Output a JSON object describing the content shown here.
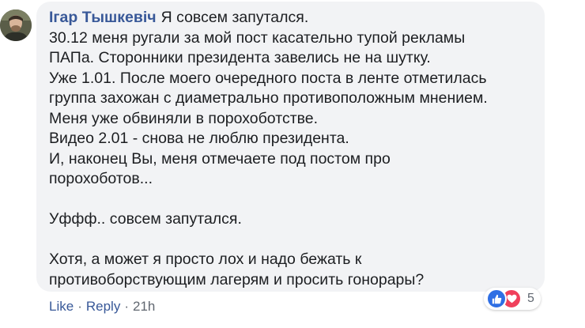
{
  "comment": {
    "author": "Ігар Тышкевіч",
    "lines": [
      "Я совсем запутался.",
      "30.12 меня ругали за мой пост касательно тупой рекламы",
      "ПАПа. Сторонники президента завелись не на шутку.",
      "Уже 1.01. После моего очередного поста в ленте отметилась",
      "группа захожан с диаметрально противоположным мнением.",
      "Меня уже обвиняли в порохоботстве.",
      "Видео 2.01 - снова не люблю президента.",
      "И, наконец Вы, меня отмечаете под постом про",
      "порохоботов...",
      "Уффф.. совсем запутался.",
      "Хотя, а может я просто лох и надо бежать к",
      "противоборствующим лагерям и просить гонорары?"
    ]
  },
  "actions": {
    "like_label": "Like",
    "separator": "·",
    "reply_label": "Reply",
    "time": "21h"
  },
  "reactions": {
    "icons": [
      "like-icon",
      "love-icon"
    ],
    "count": "5",
    "colors": {
      "like": "#2f6fe4",
      "love": "#f0405b"
    }
  },
  "colors": {
    "bubble_bg": "#f2f3f5",
    "author": "#385898",
    "text": "#1c1e21",
    "meta": "#606770"
  }
}
